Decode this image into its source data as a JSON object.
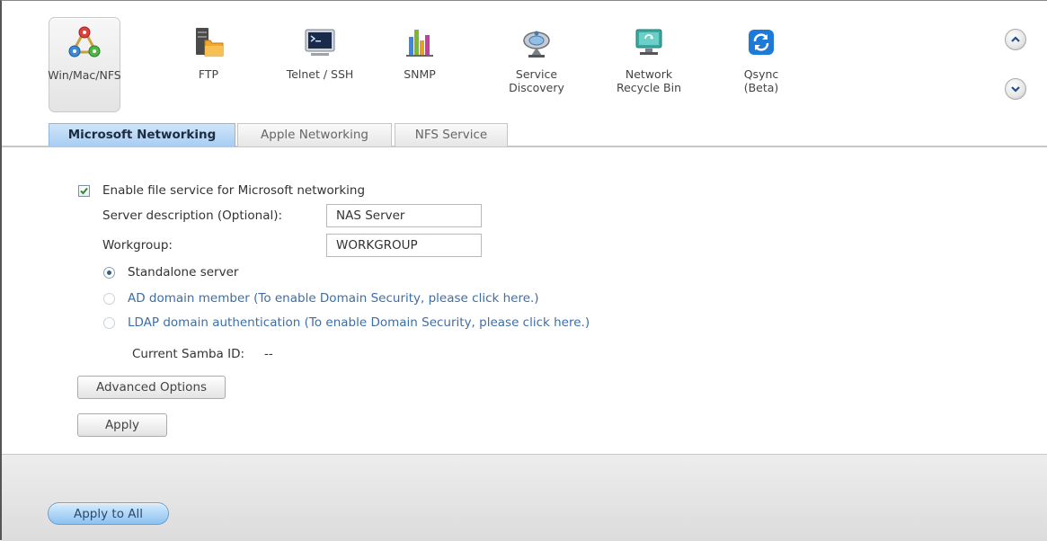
{
  "toolbar": {
    "items": [
      {
        "label": "Win/Mac/NFS",
        "icon": "network-share-icon",
        "selected": true
      },
      {
        "label": "FTP",
        "icon": "ftp-server-icon"
      },
      {
        "label": "Telnet / SSH",
        "icon": "terminal-icon"
      },
      {
        "label": "SNMP",
        "icon": "bar-graph-icon"
      },
      {
        "label": "Service\nDiscovery",
        "icon": "satellite-dish-icon"
      },
      {
        "label": "Network\nRecycle Bin",
        "icon": "recycle-bin-icon"
      },
      {
        "label": "Qsync (Beta)",
        "icon": "sync-icon"
      }
    ],
    "scroll_up_icon": "chevron-up-icon",
    "scroll_down_icon": "chevron-down-icon"
  },
  "tabs": [
    {
      "label": "Microsoft Networking",
      "active": true
    },
    {
      "label": "Apple Networking"
    },
    {
      "label": "NFS Service"
    }
  ],
  "form": {
    "enable_label": "Enable file service for Microsoft networking",
    "enable_checked": true,
    "server_description_label": "Server description (Optional):",
    "server_description_value": "NAS Server",
    "workgroup_label": "Workgroup:",
    "workgroup_value": "WORKGROUP",
    "radio_standalone": "Standalone server",
    "radio_ad": "AD domain member (To enable Domain Security, please click here.)",
    "radio_ldap": "LDAP domain authentication (To enable Domain Security, please click here.)",
    "selected_mode": "Standalone server",
    "samba_id_label": "Current Samba ID:",
    "samba_id_value": "--",
    "advanced_button": "Advanced Options",
    "apply_button": "Apply"
  },
  "footer": {
    "apply_all_button": "Apply to All"
  },
  "colors": {
    "active_tab": "#a8cdf2",
    "link_text": "#3d6ea8",
    "apply_all": "#8cc2f0"
  }
}
